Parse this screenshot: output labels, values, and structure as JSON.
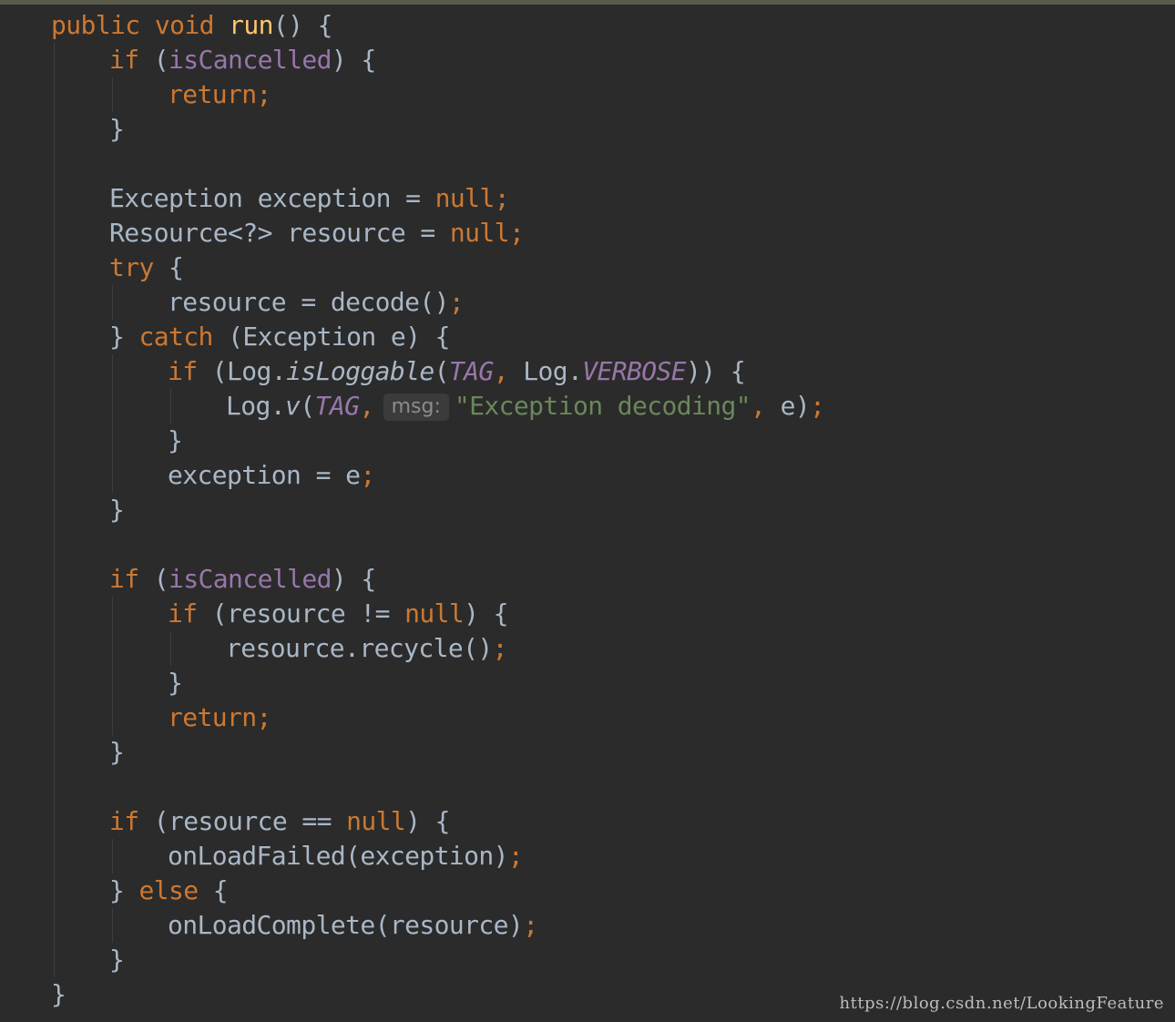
{
  "editor": {
    "theme": {
      "background": "#2b2b2b",
      "default_text": "#a9b7c6",
      "keyword": "#cc7832",
      "method_declaration": "#ffc66d",
      "field": "#9876aa",
      "string": "#6a8759",
      "parameter_hint": "#8c8c8c"
    },
    "lines": [
      {
        "indent": 0,
        "tokens": [
          {
            "t": "public",
            "k": "keyword"
          },
          {
            "t": " ",
            "k": "default"
          },
          {
            "t": "void",
            "k": "keyword"
          },
          {
            "t": " ",
            "k": "default"
          },
          {
            "t": "run",
            "k": "method-decl"
          },
          {
            "t": "() {",
            "k": "default"
          }
        ]
      },
      {
        "indent": 1,
        "tokens": [
          {
            "t": "if",
            "k": "keyword"
          },
          {
            "t": " (",
            "k": "default"
          },
          {
            "t": "isCancelled",
            "k": "field"
          },
          {
            "t": ") {",
            "k": "default"
          }
        ]
      },
      {
        "indent": 2,
        "tokens": [
          {
            "t": "return;",
            "k": "keyword"
          }
        ]
      },
      {
        "indent": 1,
        "tokens": [
          {
            "t": "}",
            "k": "default"
          }
        ]
      },
      {
        "indent": 0,
        "tokens": []
      },
      {
        "indent": 1,
        "tokens": [
          {
            "t": "Exception exception = ",
            "k": "default"
          },
          {
            "t": "null;",
            "k": "keyword"
          }
        ]
      },
      {
        "indent": 1,
        "tokens": [
          {
            "t": "Resource<?> resource = ",
            "k": "default"
          },
          {
            "t": "null;",
            "k": "keyword"
          }
        ]
      },
      {
        "indent": 1,
        "tokens": [
          {
            "t": "try",
            "k": "keyword"
          },
          {
            "t": " {",
            "k": "default"
          }
        ]
      },
      {
        "indent": 2,
        "tokens": [
          {
            "t": "resource = decode()",
            "k": "default"
          },
          {
            "t": ";",
            "k": "keyword"
          }
        ]
      },
      {
        "indent": 1,
        "tokens": [
          {
            "t": "} ",
            "k": "default"
          },
          {
            "t": "catch",
            "k": "keyword"
          },
          {
            "t": " (Exception e) {",
            "k": "default"
          }
        ]
      },
      {
        "indent": 2,
        "tokens": [
          {
            "t": "if",
            "k": "keyword"
          },
          {
            "t": " (Log.",
            "k": "default"
          },
          {
            "t": "isLoggable",
            "k": "static-call"
          },
          {
            "t": "(",
            "k": "default"
          },
          {
            "t": "TAG",
            "k": "field-italic"
          },
          {
            "t": ", ",
            "k": "keyword"
          },
          {
            "t": "Log.",
            "k": "default"
          },
          {
            "t": "VERBOSE",
            "k": "field-italic"
          },
          {
            "t": ")) {",
            "k": "default"
          }
        ]
      },
      {
        "indent": 3,
        "tokens": [
          {
            "t": "Log.",
            "k": "default"
          },
          {
            "t": "v",
            "k": "static-call"
          },
          {
            "t": "(",
            "k": "default"
          },
          {
            "t": "TAG",
            "k": "field-italic"
          },
          {
            "t": ",",
            "k": "keyword"
          },
          {
            "t": "msg:",
            "k": "hint"
          },
          {
            "t": "\"Exception decoding\"",
            "k": "string"
          },
          {
            "t": ", ",
            "k": "keyword"
          },
          {
            "t": "e)",
            "k": "default"
          },
          {
            "t": ";",
            "k": "keyword"
          }
        ]
      },
      {
        "indent": 2,
        "tokens": [
          {
            "t": "}",
            "k": "default"
          }
        ]
      },
      {
        "indent": 2,
        "tokens": [
          {
            "t": "exception = e",
            "k": "default"
          },
          {
            "t": ";",
            "k": "keyword"
          }
        ]
      },
      {
        "indent": 1,
        "tokens": [
          {
            "t": "}",
            "k": "default"
          }
        ]
      },
      {
        "indent": 0,
        "tokens": []
      },
      {
        "indent": 1,
        "tokens": [
          {
            "t": "if",
            "k": "keyword"
          },
          {
            "t": " (",
            "k": "default"
          },
          {
            "t": "isCancelled",
            "k": "field"
          },
          {
            "t": ") {",
            "k": "default"
          }
        ]
      },
      {
        "indent": 2,
        "tokens": [
          {
            "t": "if",
            "k": "keyword"
          },
          {
            "t": " (resource != ",
            "k": "default"
          },
          {
            "t": "null",
            "k": "keyword"
          },
          {
            "t": ") {",
            "k": "default"
          }
        ]
      },
      {
        "indent": 3,
        "tokens": [
          {
            "t": "resource.recycle()",
            "k": "default"
          },
          {
            "t": ";",
            "k": "keyword"
          }
        ]
      },
      {
        "indent": 2,
        "tokens": [
          {
            "t": "}",
            "k": "default"
          }
        ]
      },
      {
        "indent": 2,
        "tokens": [
          {
            "t": "return;",
            "k": "keyword"
          }
        ]
      },
      {
        "indent": 1,
        "tokens": [
          {
            "t": "}",
            "k": "default"
          }
        ]
      },
      {
        "indent": 0,
        "tokens": []
      },
      {
        "indent": 1,
        "tokens": [
          {
            "t": "if",
            "k": "keyword"
          },
          {
            "t": " (resource == ",
            "k": "default"
          },
          {
            "t": "null",
            "k": "keyword"
          },
          {
            "t": ") {",
            "k": "default"
          }
        ]
      },
      {
        "indent": 2,
        "tokens": [
          {
            "t": "onLoadFailed(exception)",
            "k": "default"
          },
          {
            "t": ";",
            "k": "keyword"
          }
        ]
      },
      {
        "indent": 1,
        "tokens": [
          {
            "t": "} ",
            "k": "default"
          },
          {
            "t": "else",
            "k": "keyword"
          },
          {
            "t": " {",
            "k": "default"
          }
        ]
      },
      {
        "indent": 2,
        "tokens": [
          {
            "t": "onLoadComplete(resource)",
            "k": "default"
          },
          {
            "t": ";",
            "k": "keyword"
          }
        ]
      },
      {
        "indent": 1,
        "tokens": [
          {
            "t": "}",
            "k": "default"
          }
        ]
      },
      {
        "indent": 0,
        "tokens": [
          {
            "t": "}",
            "k": "default"
          }
        ]
      }
    ]
  },
  "watermark": {
    "text": "https://blog.csdn.net/LookingFeature"
  }
}
